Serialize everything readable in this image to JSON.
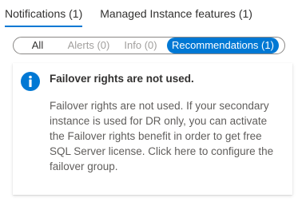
{
  "tabs": [
    {
      "label": "Notifications (1)"
    },
    {
      "label": "Managed Instance features (1)"
    }
  ],
  "filters": {
    "all": "All",
    "alerts": "Alerts (0)",
    "info": "Info (0)",
    "recommendations": "Recommendations (1)"
  },
  "notification": {
    "icon": "info-icon",
    "title": "Failover rights are not used.",
    "body": "Failover rights are not used. If your secondary instance is used for DR only, you can activate the Failover rights benefit in order to get free SQL Server license. Click here to configure the failover group."
  },
  "colors": {
    "accent": "#0078d4",
    "info_icon": "#0078d4"
  }
}
